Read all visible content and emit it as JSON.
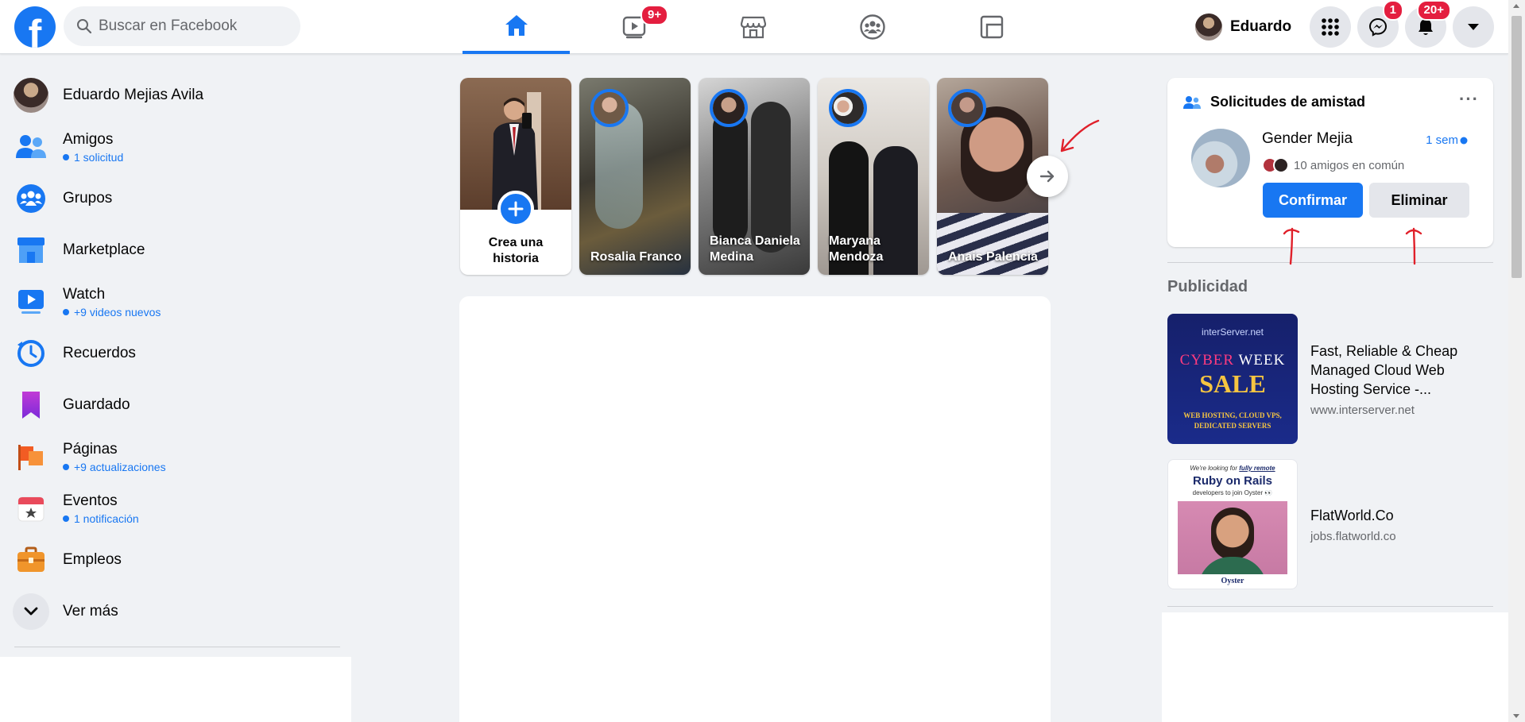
{
  "colors": {
    "brand": "#1877f2",
    "badge": "#e41e3f",
    "background": "#f0f2f5",
    "annotation": "#e0202a"
  },
  "header": {
    "logo_letter": "f",
    "search_placeholder": "Buscar en Facebook",
    "nav_tabs": [
      {
        "icon": "home-icon",
        "active": true
      },
      {
        "icon": "watch-icon",
        "badge": "9+"
      },
      {
        "icon": "marketplace-icon"
      },
      {
        "icon": "groups-icon"
      },
      {
        "icon": "gaming-icon"
      }
    ],
    "profile_name": "Eduardo",
    "messenger_badge": "1",
    "notifications_badge": "20+"
  },
  "sidebar": {
    "user_name": "Eduardo Mejias Avila",
    "items": [
      {
        "label": "Amigos",
        "sub": "1 solicitud",
        "icon": "friends-icon"
      },
      {
        "label": "Grupos",
        "icon": "groups-icon"
      },
      {
        "label": "Marketplace",
        "icon": "marketplace-icon"
      },
      {
        "label": "Watch",
        "sub": "+9 videos nuevos",
        "icon": "watch-icon"
      },
      {
        "label": "Recuerdos",
        "icon": "memories-icon"
      },
      {
        "label": "Guardado",
        "icon": "saved-icon"
      },
      {
        "label": "Páginas",
        "sub": "+9 actualizaciones",
        "icon": "pages-icon"
      },
      {
        "label": "Eventos",
        "sub": "1 notificación",
        "icon": "events-icon"
      },
      {
        "label": "Empleos",
        "icon": "jobs-icon"
      }
    ],
    "see_more": "Ver más"
  },
  "stories": {
    "create_label": "Crea una historia",
    "items": [
      {
        "name": "Rosalia Franco"
      },
      {
        "name": "Bianca Daniela Medina"
      },
      {
        "name": "Maryana Mendoza"
      },
      {
        "name": "Anais Palencia"
      }
    ]
  },
  "friend_requests": {
    "title": "Solicitudes de amistad",
    "more": "···",
    "name": "Gender Mejia",
    "time": "1 sem",
    "mutual": "10 amigos en común",
    "confirm": "Confirmar",
    "delete": "Eliminar"
  },
  "ads": {
    "title": "Publicidad",
    "items": [
      {
        "title": "Fast, Reliable & Cheap Managed Cloud Web Hosting Service -...",
        "url": "www.interserver.net",
        "image": {
          "brand": "interServer.net",
          "line1a": "CYBER",
          "line1b": "WEEK",
          "line2": "SALE",
          "line3": "WEB HOSTING, CLOUD VPS, DEDICATED SERVERS"
        }
      },
      {
        "title": "FlatWorld.Co",
        "url": "jobs.flatworld.co",
        "image": {
          "top_a": "We're looking for",
          "top_b": "fully remote",
          "headline": "Ruby on Rails",
          "sub": "developers to join Oyster 👀",
          "brand": "Oyster"
        }
      }
    ]
  }
}
